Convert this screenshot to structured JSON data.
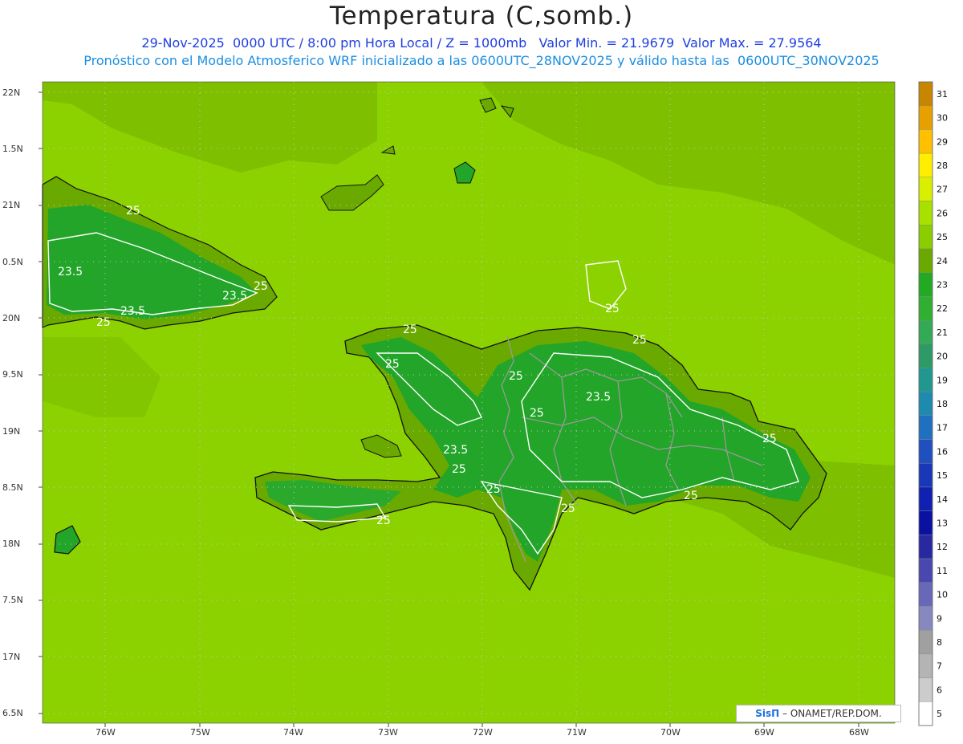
{
  "header": {
    "title": "Temperatura (C,somb.)",
    "line1": "29-Nov-2025  0000 UTC / 8:00 pm Hora Local / Z = 1000mb   Valor Min. = 21.9679  Valor Max. = 27.9564",
    "line2": "Pronóstico con el Modelo Atmosferico WRF inicializado a las 0600UTC_28NOV2025 y válido hasta las  0600UTC_30NOV2025"
  },
  "axes": {
    "lat_labels": [
      "22N",
      "1.5N",
      "21N",
      "0.5N",
      "20N",
      "9.5N",
      "19N",
      "8.5N",
      "18N",
      "7.5N",
      "17N",
      "6.5N"
    ],
    "lon_labels": [
      "76W",
      "75W",
      "74W",
      "73W",
      "72W",
      "71W",
      "70W",
      "69W",
      "68W"
    ]
  },
  "colorbar": {
    "labels": [
      "31",
      "30",
      "29",
      "28",
      "27",
      "26",
      "25",
      "24",
      "23",
      "22",
      "21",
      "20",
      "19",
      "18",
      "17",
      "16",
      "15",
      "14",
      "13",
      "12",
      "11",
      "10",
      "9",
      "8",
      "7",
      "6",
      "5"
    ],
    "colors": [
      "#c88600",
      "#e6a000",
      "#ffc000",
      "#ffee00",
      "#d8f000",
      "#a8e000",
      "#8ccd00",
      "#6aaa00",
      "#22aa22",
      "#30b030",
      "#33aa55",
      "#2e9a66",
      "#209890",
      "#1f8ab0",
      "#2070c0",
      "#2050c0",
      "#1838b8",
      "#1020b0",
      "#0a10a0",
      "#2828a0",
      "#4848b0",
      "#6868b8",
      "#8888c0",
      "#a0a0a0",
      "#b4b4b4",
      "#cccccc",
      "#ffffff"
    ]
  },
  "contour_labels": [
    "25",
    "23.5",
    "23.5",
    "25",
    "25",
    "23.5",
    "25",
    "25",
    "25",
    "25",
    "25",
    "23.5",
    "25",
    "23.5",
    "25",
    "25",
    "25",
    "25",
    "25",
    "25"
  ],
  "credit": {
    "brand": "SisΠ",
    "text": " – ONAMET/REP.DOM."
  },
  "map_colors": {
    "sea": "#8cd200",
    "land_warm": "#6aaa00",
    "land_cool": "#22a528",
    "coast": "#111111",
    "provinces": "#9a9a9a",
    "contour": "#ffffff"
  }
}
